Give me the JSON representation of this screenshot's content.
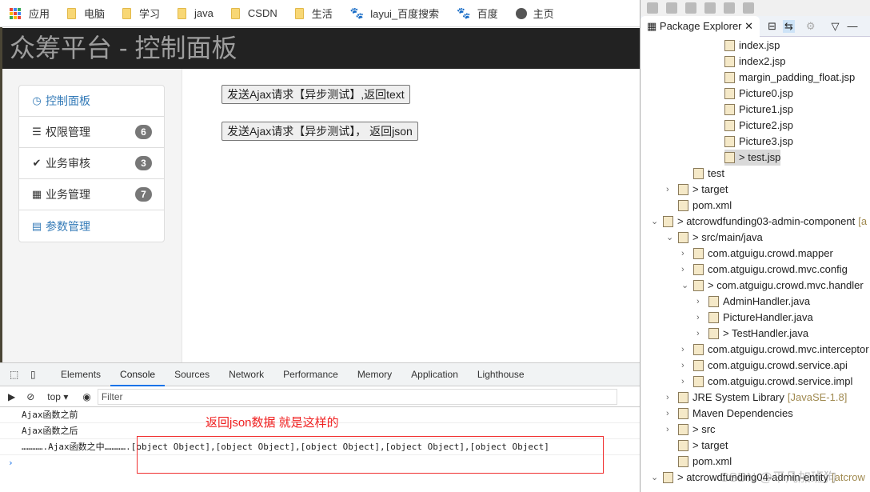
{
  "bookmarks": [
    {
      "icon": "apps-grid-icon",
      "label": "应用"
    },
    {
      "icon": "folder-icon",
      "label": "电脑"
    },
    {
      "icon": "folder-icon",
      "label": "学习"
    },
    {
      "icon": "folder-icon",
      "label": "java"
    },
    {
      "icon": "folder-icon",
      "label": "CSDN"
    },
    {
      "icon": "folder-icon",
      "label": "生活"
    },
    {
      "icon": "baidu-paw-icon",
      "label": "layui_百度搜索"
    },
    {
      "icon": "baidu-paw-icon",
      "label": "百度"
    },
    {
      "icon": "globe-icon",
      "label": "主页"
    }
  ],
  "header": {
    "title": "众筹平台 - 控制面板"
  },
  "sidebar": {
    "items": [
      {
        "icon": "dashboard-icon",
        "label": "控制面板",
        "badge": null,
        "active": true
      },
      {
        "icon": "tasks-icon",
        "label": "权限管理",
        "badge": "6"
      },
      {
        "icon": "check-icon",
        "label": "业务审核",
        "badge": "3"
      },
      {
        "icon": "th-large-icon",
        "label": "业务管理",
        "badge": "7"
      },
      {
        "icon": "list-alt-icon",
        "label": "参数管理",
        "badge": null,
        "active": true
      }
    ]
  },
  "main": {
    "btn_text": "发送Ajax请求【异步测试】,返回text",
    "btn_json": "发送Ajax请求【异步测试】， 返回json"
  },
  "devtools": {
    "tabs": [
      "Elements",
      "Console",
      "Sources",
      "Network",
      "Performance",
      "Memory",
      "Application",
      "Lighthouse"
    ],
    "active_tab": "Console",
    "context": "top",
    "filter_placeholder": "Filter",
    "console": [
      "Ajax函数之前",
      "Ajax函数之后",
      "………….Ajax函数之中………….[object Object],[object Object],[object Object],[object Object],[object Object]"
    ],
    "prompt": "›"
  },
  "annotation": "返回json数据 就是这样的",
  "eclipse": {
    "view_title": "Package Explorer",
    "tree": [
      {
        "lvl": 5,
        "chev": "",
        "text": "index.jsp"
      },
      {
        "lvl": 5,
        "chev": "",
        "text": "index2.jsp"
      },
      {
        "lvl": 5,
        "chev": "",
        "text": "margin_padding_float.jsp"
      },
      {
        "lvl": 5,
        "chev": "",
        "text": "Picture0.jsp"
      },
      {
        "lvl": 5,
        "chev": "",
        "text": "Picture1.jsp"
      },
      {
        "lvl": 5,
        "chev": "",
        "text": "Picture2.jsp"
      },
      {
        "lvl": 5,
        "chev": "",
        "text": "Picture3.jsp"
      },
      {
        "lvl": 5,
        "chev": "",
        "text": "> test.jsp",
        "sel": true
      },
      {
        "lvl": 3,
        "chev": "",
        "text": "test"
      },
      {
        "lvl": 2,
        "chev": ">",
        "text": "> target"
      },
      {
        "lvl": 2,
        "chev": "",
        "text": "pom.xml"
      },
      {
        "lvl": 1,
        "chev": "v",
        "text": "> atcrowdfunding03-admin-component",
        "deco": "[a"
      },
      {
        "lvl": 2,
        "chev": "v",
        "text": "> src/main/java"
      },
      {
        "lvl": 3,
        "chev": ">",
        "text": "com.atguigu.crowd.mapper"
      },
      {
        "lvl": 3,
        "chev": ">",
        "text": "com.atguigu.crowd.mvc.config"
      },
      {
        "lvl": 3,
        "chev": "v",
        "text": "> com.atguigu.crowd.mvc.handler"
      },
      {
        "lvl": 4,
        "chev": ">",
        "text": "AdminHandler.java"
      },
      {
        "lvl": 4,
        "chev": ">",
        "text": "PictureHandler.java"
      },
      {
        "lvl": 4,
        "chev": ">",
        "text": "> TestHandler.java"
      },
      {
        "lvl": 3,
        "chev": ">",
        "text": "com.atguigu.crowd.mvc.interceptor"
      },
      {
        "lvl": 3,
        "chev": ">",
        "text": "com.atguigu.crowd.service.api"
      },
      {
        "lvl": 3,
        "chev": ">",
        "text": "com.atguigu.crowd.service.impl"
      },
      {
        "lvl": 2,
        "chev": ">",
        "text": "JRE System Library",
        "deco": "[JavaSE-1.8]"
      },
      {
        "lvl": 2,
        "chev": ">",
        "text": "Maven Dependencies"
      },
      {
        "lvl": 2,
        "chev": ">",
        "text": "> src"
      },
      {
        "lvl": 2,
        "chev": "",
        "text": "> target"
      },
      {
        "lvl": 2,
        "chev": "",
        "text": "pom.xml"
      },
      {
        "lvl": 1,
        "chev": "v",
        "text": "> atcrowdfunding04-admin-entity",
        "deco": "[atcrow"
      }
    ]
  },
  "watermark": "CSDN @平凡加班狗"
}
